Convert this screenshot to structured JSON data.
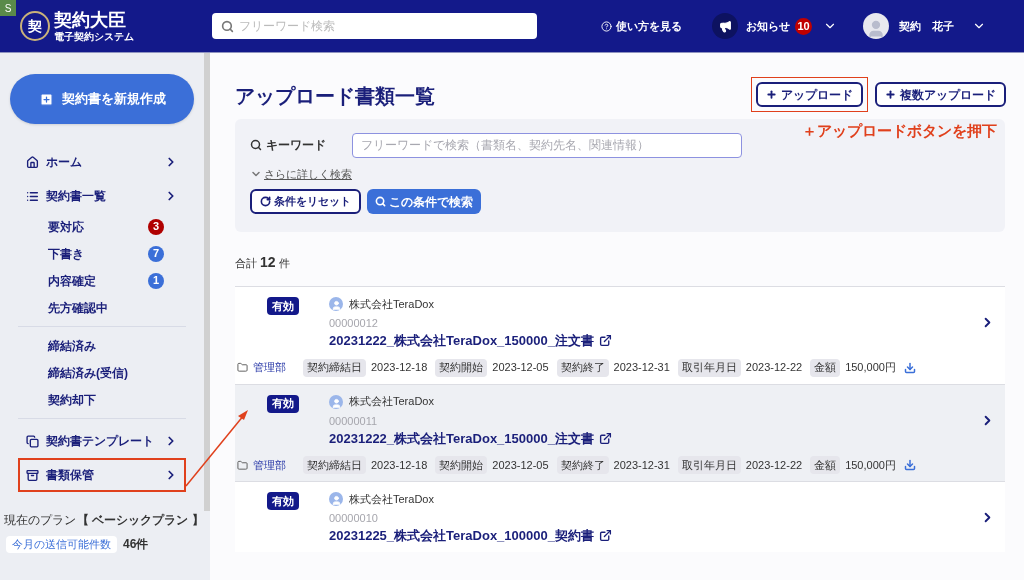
{
  "corner_tag": "S",
  "header": {
    "logo_mark": "契",
    "logo_title": "契約大臣",
    "logo_subtitle": "電子契約システム",
    "search_placeholder": "フリーワード検索",
    "help": "使い方を見る",
    "notifications": "お知らせ",
    "notification_count": "10",
    "user": "契約　花子"
  },
  "sidebar": {
    "new_button": "契約書を新規作成",
    "groups": [
      [
        {
          "kind": "main",
          "label": "ホーム",
          "annotated": false
        },
        {
          "kind": "main",
          "label": "契約書一覧",
          "annotated": false
        },
        {
          "kind": "sub",
          "label": "要対応",
          "badge": "3",
          "color": "#b00000"
        },
        {
          "kind": "sub",
          "label": "下書き",
          "badge": "7",
          "color": "#3b6fd8"
        },
        {
          "kind": "sub",
          "label": "内容確定",
          "badge": "1",
          "color": "#3b6fd8"
        },
        {
          "kind": "sub",
          "label": "先方確認中"
        }
      ],
      [
        {
          "kind": "sub",
          "label": "締結済み"
        },
        {
          "kind": "sub",
          "label": "締結済み(受信)"
        },
        {
          "kind": "sub",
          "label": "契約却下"
        }
      ],
      [
        {
          "kind": "main",
          "label": "契約書テンプレート",
          "annotated": false
        },
        {
          "kind": "main",
          "label": "書類保管",
          "annotated": true
        }
      ]
    ],
    "plan_label": "現在のプラン",
    "plan_name": "【 ベーシックプラン 】",
    "quota_label": "今月の送信可能件数",
    "quota_value": "46件"
  },
  "main": {
    "title": "アップロード書類一覧",
    "buttons": [
      {
        "label": "アップロード",
        "annotated": true
      },
      {
        "label": "複数アップロード",
        "annotated": false
      }
    ],
    "callout": "＋アップロードボタンを押下",
    "search": {
      "label": "キーワード",
      "placeholder": "フリーワードで検索（書類名、契約先名、関連情報）",
      "advanced": "さらに詳しく検索",
      "reset": "条件をリセット",
      "submit": "この条件で検索"
    },
    "total": {
      "prefix": "合計",
      "count": "12",
      "suffix": "件"
    },
    "documents": [
      {
        "status": "有効",
        "company": "株式会社TeraDox",
        "number": "00000012",
        "title": "20231222_株式会社TeraDox_150000_注文書",
        "highlighted": false,
        "folder": "管理部",
        "meta": [
          {
            "label": "契約締結日",
            "value": "2023-12-18"
          },
          {
            "label": "契約開始",
            "value": "2023-12-05"
          },
          {
            "label": "契約終了",
            "value": "2023-12-31"
          },
          {
            "label": "取引年月日",
            "value": "2023-12-22"
          },
          {
            "label": "金額",
            "value": "150,000円"
          }
        ]
      },
      {
        "status": "有効",
        "company": "株式会社TeraDox",
        "number": "00000011",
        "title": "20231222_株式会社TeraDox_150000_注文書",
        "highlighted": true,
        "folder": "管理部",
        "meta": [
          {
            "label": "契約締結日",
            "value": "2023-12-18"
          },
          {
            "label": "契約開始",
            "value": "2023-12-05"
          },
          {
            "label": "契約終了",
            "value": "2023-12-31"
          },
          {
            "label": "取引年月日",
            "value": "2023-12-22"
          },
          {
            "label": "金額",
            "value": "150,000円"
          }
        ]
      },
      {
        "status": "有効",
        "company": "株式会社TeraDox",
        "number": "00000010",
        "title": "20231225_株式会社TeraDox_100000_契約書",
        "highlighted": false
      }
    ]
  }
}
